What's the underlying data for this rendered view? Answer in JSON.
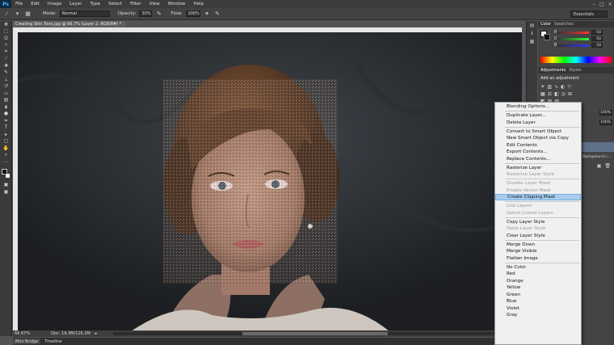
{
  "app": {
    "logo": "Ps"
  },
  "menubar": {
    "items": [
      "File",
      "Edit",
      "Image",
      "Layer",
      "Type",
      "Select",
      "Filter",
      "View",
      "Window",
      "Help"
    ]
  },
  "options": {
    "mode_label": "Mode:",
    "mode_value": "Normal",
    "opacity_label": "Opacity:",
    "opacity_value": "30%",
    "flow_label": "Flow:",
    "flow_value": "100%",
    "workspace": "Essentials"
  },
  "document": {
    "tab_title": "Creating Skin Tone.jpg @ 66.7% (Layer 2, RGB/8#) *",
    "zoom": "66.67%",
    "doc_info": "Doc: 19.3M/126.2M"
  },
  "bottom_tabs": [
    "Mini Bridge",
    "Timeline"
  ],
  "panels": {
    "color_tabs": [
      "Color",
      "Swatches"
    ],
    "color_sliders": [
      {
        "label": "R",
        "value": "50"
      },
      {
        "label": "G",
        "value": "50"
      },
      {
        "label": "B",
        "value": "50"
      }
    ],
    "adj_tabs": [
      "Adjustments",
      "Styles"
    ],
    "adj_title": "Add an adjustment",
    "layer_opacity": "100%",
    "layer_fill": "100%",
    "layer_label": "Background c..."
  },
  "context_menu": {
    "groups": [
      [
        {
          "label": "Blending Options...",
          "state": "normal"
        }
      ],
      [
        {
          "label": "Duplicate Layer...",
          "state": "normal"
        },
        {
          "label": "Delete Layer",
          "state": "normal"
        }
      ],
      [
        {
          "label": "Convert to Smart Object",
          "state": "normal"
        },
        {
          "label": "New Smart Object via Copy",
          "state": "normal"
        },
        {
          "label": "Edit Contents",
          "state": "normal"
        },
        {
          "label": "Export Contents...",
          "state": "normal"
        },
        {
          "label": "Replace Contents...",
          "state": "normal"
        }
      ],
      [
        {
          "label": "Rasterize Layer",
          "state": "normal"
        },
        {
          "label": "Rasterize Layer Style",
          "state": "disabled"
        }
      ],
      [
        {
          "label": "Disable Layer Mask",
          "state": "disabled"
        },
        {
          "label": "Enable Vector Mask",
          "state": "disabled"
        },
        {
          "label": "Create Clipping Mask",
          "state": "highlighted"
        }
      ],
      [
        {
          "label": "Link Layers",
          "state": "disabled"
        },
        {
          "label": "Select Linked Layers",
          "state": "disabled"
        }
      ],
      [
        {
          "label": "Copy Layer Style",
          "state": "normal"
        },
        {
          "label": "Paste Layer Style",
          "state": "disabled"
        },
        {
          "label": "Clear Layer Style",
          "state": "normal"
        }
      ],
      [
        {
          "label": "Merge Down",
          "state": "normal"
        },
        {
          "label": "Merge Visible",
          "state": "normal"
        },
        {
          "label": "Flatten Image",
          "state": "normal"
        }
      ],
      [
        {
          "label": "No Color",
          "state": "normal"
        },
        {
          "label": "Red",
          "state": "normal"
        },
        {
          "label": "Orange",
          "state": "normal"
        },
        {
          "label": "Yellow",
          "state": "normal"
        },
        {
          "label": "Green",
          "state": "normal"
        },
        {
          "label": "Blue",
          "state": "normal"
        },
        {
          "label": "Violet",
          "state": "normal"
        },
        {
          "label": "Gray",
          "state": "normal"
        }
      ]
    ]
  }
}
